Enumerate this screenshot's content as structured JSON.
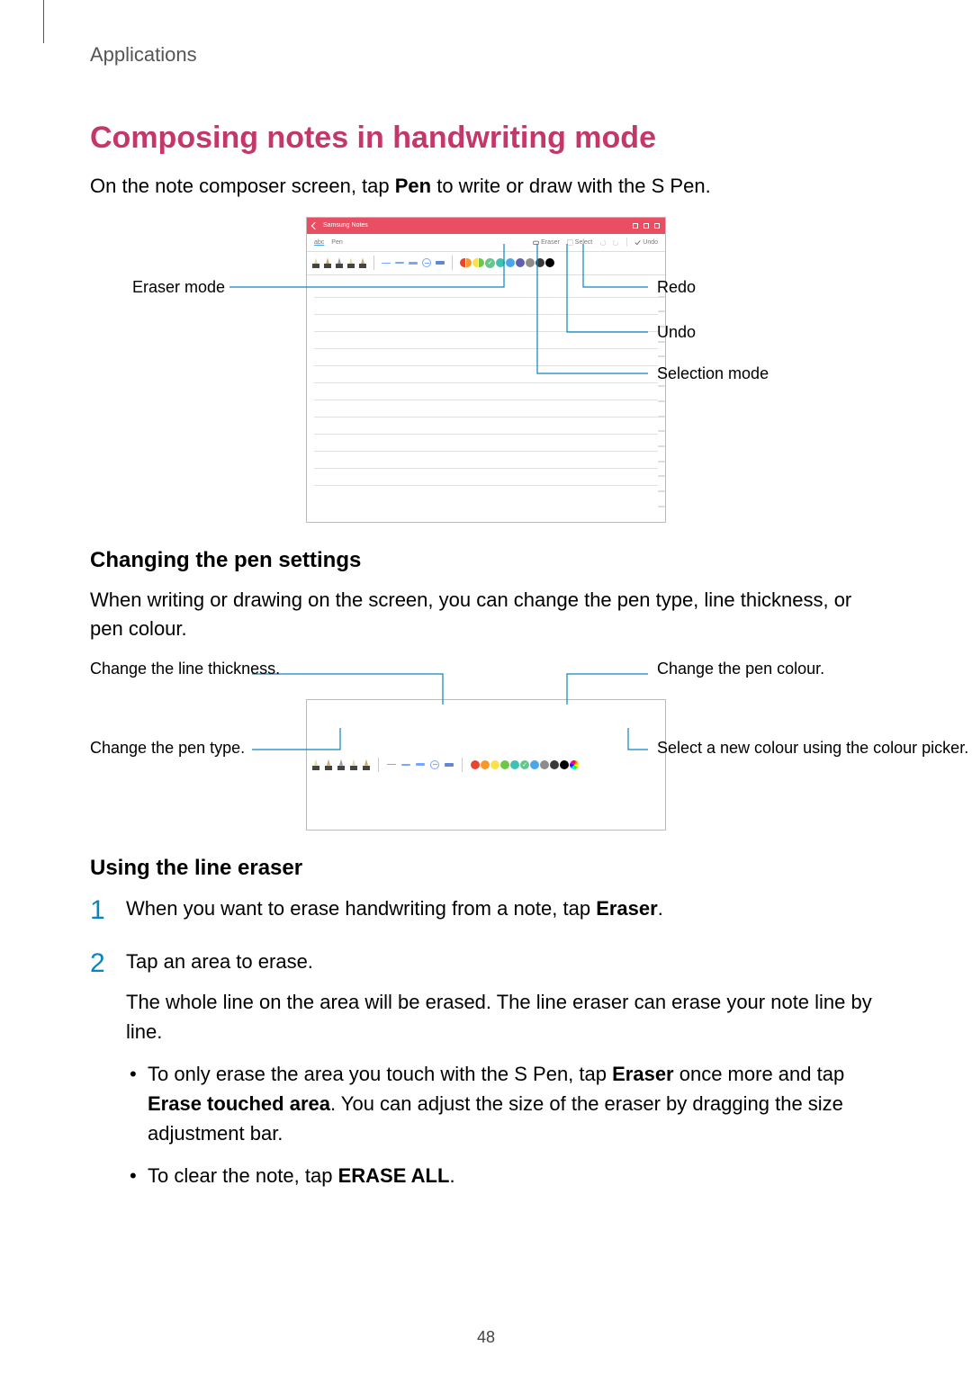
{
  "breadcrumb": "Applications",
  "title": "Composing notes in handwriting mode",
  "intro_pre": "On the note composer screen, tap ",
  "intro_bold": "Pen",
  "intro_post": " to write or draw with the S Pen.",
  "shot1": {
    "app_name": "Samsung Notes",
    "tab_abc": "abc",
    "tab_pen": "Pen",
    "icon_eraser": "Eraser",
    "icon_select": "Select",
    "icon_undo": "Undo",
    "callout_eraser": "Eraser mode",
    "callout_redo": "Redo",
    "callout_undo": "Undo",
    "callout_selection": "Selection mode"
  },
  "sub1": "Changing the pen settings",
  "para1": "When writing or drawing on the screen, you can change the pen type, line thickness, or pen colour.",
  "shot2": {
    "callout_thickness": "Change the line thickness.",
    "callout_pentype": "Change the pen type.",
    "callout_colour": "Change the pen colour.",
    "callout_picker": "Select a new colour using the colour picker."
  },
  "sub2": "Using the line eraser",
  "step1_pre": "When you want to erase handwriting from a note, tap ",
  "step1_bold": "Eraser",
  "step1_post": ".",
  "step2_line1": "Tap an area to erase.",
  "step2_line2": "The whole line on the area will be erased. The line eraser can erase your note line by line.",
  "bullet1_a": "To only erase the area you touch with the S Pen, tap ",
  "bullet1_b1": "Eraser",
  "bullet1_c": " once more and tap ",
  "bullet1_b2": "Erase touched area",
  "bullet1_d": ". You can adjust the size of the eraser by dragging the size adjustment bar.",
  "bullet2_a": "To clear the note, tap ",
  "bullet2_b": "ERASE ALL",
  "bullet2_c": ".",
  "page_number": "48",
  "palette1": [
    "#e8452f",
    "#f59a2a",
    "#fbe14b",
    "#6fc74a",
    "#3fc1b0",
    "#49a6e8",
    "#5f5fb0",
    "#8c8c8c",
    "#3a3a3a",
    "#000000"
  ],
  "palette_sel": "#63c78b",
  "palette2": [
    "#e8452f",
    "#f59a2a",
    "#fbe14b",
    "#6fc74a",
    "#3fc1b0",
    "#63c78b",
    "#49a6e8",
    "#8c8c8c",
    "#3a3a3a",
    "#000000"
  ],
  "palette_picker": "conic-gradient(red,orange,yellow,lime,cyan,blue,magenta,red)"
}
